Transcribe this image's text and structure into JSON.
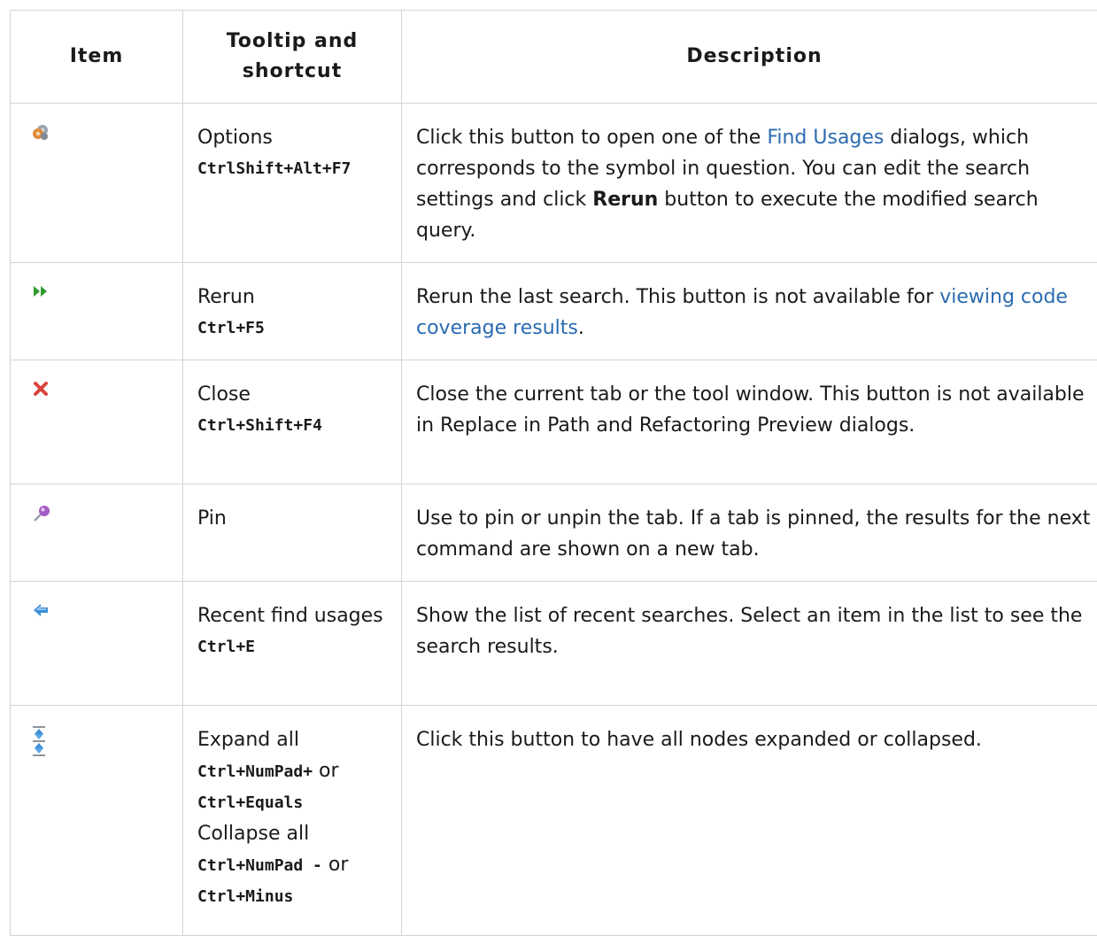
{
  "headers": {
    "item": "Item",
    "tooltip": "Tooltip and shortcut",
    "description": "Description"
  },
  "rows": [
    {
      "icon": "options-gears-icon",
      "tooltip": "Options",
      "shortcut": "CtrlShift+Alt+F7",
      "desc": {
        "pre": "Click this button to open one of the ",
        "link": "Find Usages",
        "mid": " dialogs, which corresponds to the symbol in question. You can edit the search settings and click ",
        "bold": "Rerun",
        "post": " button to execute the modified search query."
      }
    },
    {
      "icon": "rerun-icon",
      "tooltip": "Rerun",
      "shortcut": "Ctrl+F5",
      "desc": {
        "pre": "Rerun the last search. This button is not available for ",
        "link": "viewing code coverage results",
        "post": "."
      }
    },
    {
      "icon": "close-icon",
      "tooltip": "Close",
      "shortcut": "Ctrl+Shift+F4",
      "desc": {
        "text": "Close the current tab or the tool window. This button is not available in Replace in Path and Refactoring Preview dialogs."
      }
    },
    {
      "icon": "pin-icon",
      "tooltip": "Pin",
      "desc": {
        "text": "Use to pin or unpin the tab. If a tab is pinned, the results for the next command are shown on a new tab."
      }
    },
    {
      "icon": "back-arrow-icon",
      "tooltip": "Recent find usages",
      "shortcut": "Ctrl+E",
      "desc": {
        "text": "Show the list of recent searches. Select an item in the list to see the search results."
      }
    },
    {
      "icon": "expand-collapse-icon",
      "expand_label": "Expand all",
      "expand_kbd1": "Ctrl+NumPad+",
      "or1": " or",
      "expand_kbd2": "Ctrl+Equals",
      "collapse_label": "Collapse all",
      "collapse_kbd1": "Ctrl+NumPad -",
      "or2": " or",
      "collapse_kbd2": "Ctrl+Minus",
      "desc": {
        "text": "Click this button to have all nodes expanded or collapsed."
      }
    }
  ],
  "colors": {
    "link": "#2a6bb1",
    "border": "#d4d4d4",
    "rerun_green": "#2e9a2e",
    "close_red": "#d9443c"
  }
}
